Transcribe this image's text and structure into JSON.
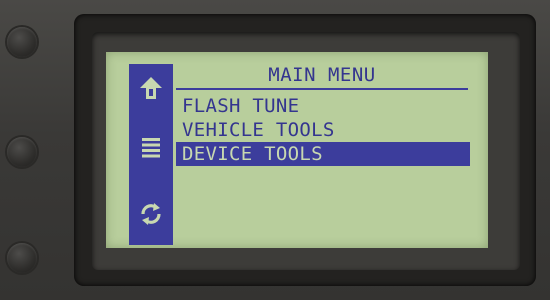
{
  "screen": {
    "title": "MAIN MENU",
    "items": [
      {
        "label": "FLASH TUNE",
        "selected": false
      },
      {
        "label": "VEHICLE TOOLS",
        "selected": false
      },
      {
        "label": "DEVICE TOOLS",
        "selected": true
      }
    ],
    "sidebar_icons": [
      "home-up-arrow-icon",
      "list-icon",
      "refresh-icon"
    ]
  },
  "colors": {
    "lcd_background": "#b8ce9c",
    "lcd_accent": "#3c3d9c",
    "housing": "#3c3b39"
  }
}
